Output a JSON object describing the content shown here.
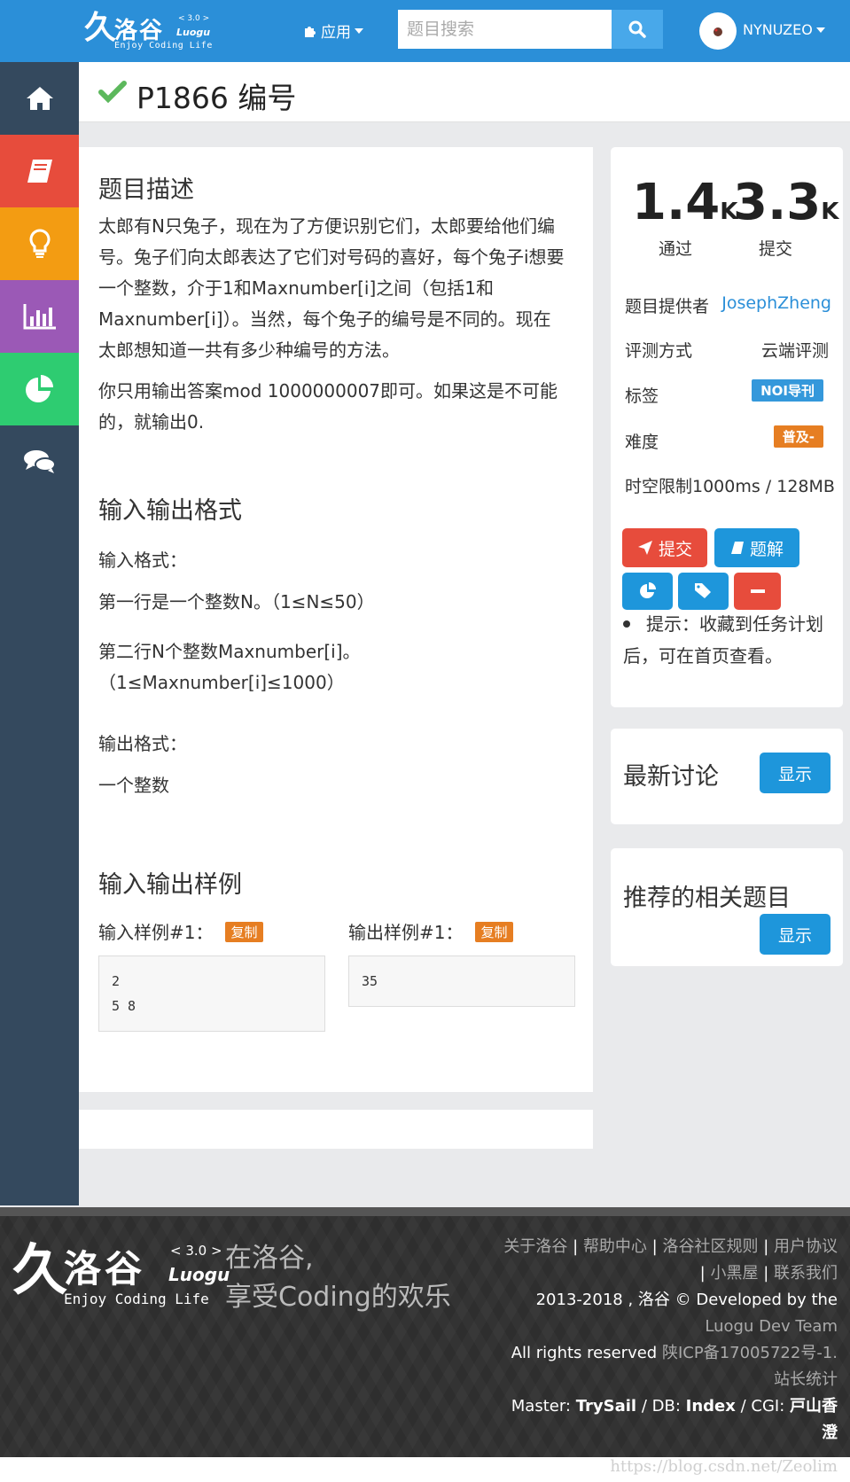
{
  "header": {
    "logo": {
      "mark": "久",
      "cn": "洛谷",
      "version": "< 3.0 >",
      "en": "Luogu",
      "tagline": "Enjoy Coding Life"
    },
    "apps_label": "应用",
    "search_placeholder": "题目搜索",
    "username": "NYNUZEO"
  },
  "sidebar": {
    "items": [
      {
        "icon": "home-icon",
        "color": "#34495e"
      },
      {
        "icon": "book-icon",
        "color": "#e74c3c"
      },
      {
        "icon": "lightbulb-icon",
        "color": "#f39c12"
      },
      {
        "icon": "bar-chart-icon",
        "color": "#9b59b6"
      },
      {
        "icon": "pie-chart-icon",
        "color": "#2ecc71"
      },
      {
        "icon": "comments-icon",
        "color": "#34495e"
      }
    ]
  },
  "problem": {
    "title": "P1866 编号",
    "desc_title": "题目描述",
    "desc_p1": "太郎有N只兔子，现在为了方便识别它们，太郎要给他们编号。兔子们向太郎表达了它们对号码的喜好，每个兔子i想要一个整数，介于1和Maxnumber[i]之间（包括1和Maxnumber[i]）。当然，每个兔子的编号是不同的。现在太郎想知道一共有多少种编号的方法。",
    "desc_p2": "你只用输出答案mod 1000000007即可。如果这是不可能的，就输出0.",
    "io_title": "输入输出格式",
    "input_label": "输入格式：",
    "input_line1": "第一行是一个整数N。（1≤N≤50）",
    "input_line2": "第二行N个整数Maxnumber[i]。（1≤Maxnumber[i]≤1000）",
    "output_label": "输出格式：",
    "output_line": "一个整数",
    "sample_title": "输入输出样例",
    "sample_in_label": "输入样例#1：",
    "sample_out_label": "输出样例#1：",
    "copy_label": "复制",
    "sample_in": "2\n5 8",
    "sample_out": "35"
  },
  "stats": {
    "passed_num": "1.4",
    "passed_unit": "K",
    "submit_num": "3.3",
    "submit_unit": "K",
    "passed_label": "通过",
    "submit_label": "提交",
    "provider_label": "题目提供者",
    "provider": "JosephZheng",
    "judge_label": "评测方式",
    "judge": "云端评测",
    "tags_label": "标签",
    "tag": "NOI导刊",
    "difficulty_label": "难度",
    "difficulty": "普及-",
    "limit": "时空限制1000ms / 128MB",
    "submit_btn": "提交",
    "solution_btn": "题解",
    "hint": "提示：收藏到任务计划后，可在首页查看。"
  },
  "discuss": {
    "title": "最新讨论",
    "show": "显示"
  },
  "related": {
    "title": "推荐的相关题目",
    "show": "显示"
  },
  "footer": {
    "logo": {
      "mark": "久",
      "cn": "洛谷",
      "version": "< 3.0 >",
      "en": "Luogu",
      "tagline": "Enjoy Coding Life"
    },
    "slogan1": "在洛谷,",
    "slogan2": "享受Coding的欢乐",
    "link_about": "关于洛谷",
    "link_help": "帮助中心",
    "link_rules": "洛谷社区规则",
    "link_agreement": "用户协议",
    "link_blackroom": "小黑屋",
    "link_contact": "联系我们",
    "copyright": "2013-2018 , 洛谷 © Developed by the",
    "team": "Luogu Dev Team",
    "rights": "All rights reserved",
    "icp": "陕ICP备17005722号-1.",
    "stats": "站长统计",
    "master_label": "Master:",
    "master": "TrySail",
    "db_label": "DB:",
    "db": "Index",
    "cgi_label": "CGI:",
    "cgi": "戸山香澄"
  },
  "watermark": "https://blog.csdn.net/Zeolim",
  "colors": {
    "brand": "#2b8fd8",
    "sidebar": "#34495e",
    "accent_blue": "#1e96db",
    "red": "#e74c3c",
    "orange": "#e67e22",
    "green_check": "#5cb85c"
  }
}
